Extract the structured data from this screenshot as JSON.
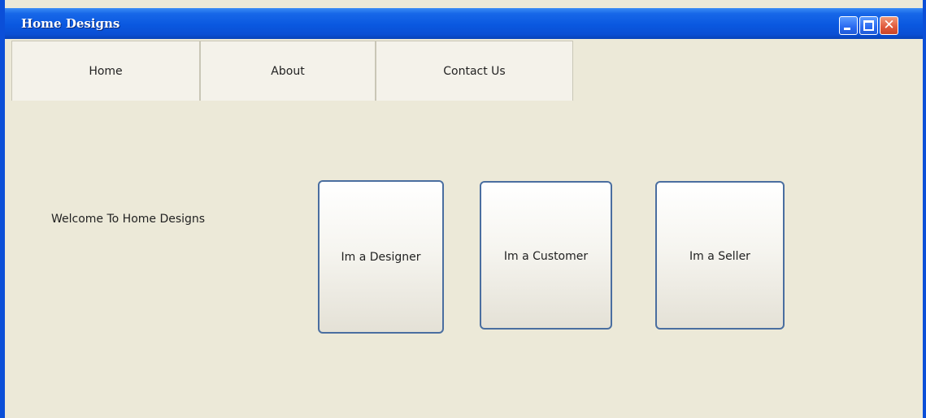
{
  "window": {
    "title": "Home Designs",
    "controls": [
      "minimize-icon",
      "maximize-icon",
      "close-icon"
    ]
  },
  "tabs": [
    {
      "label": "Home"
    },
    {
      "label": "About"
    },
    {
      "label": "Contact Us"
    }
  ],
  "main": {
    "welcome": "Welcome To Home Designs",
    "buttons": [
      {
        "label": "Im a Designer"
      },
      {
        "label": "Im a Customer"
      },
      {
        "label": "Im a Seller"
      }
    ]
  },
  "colors": {
    "titlebar": "#0a58e0",
    "background": "#ece9d8",
    "button_border": "#4a6ea0",
    "close_button": "#e0583a"
  }
}
